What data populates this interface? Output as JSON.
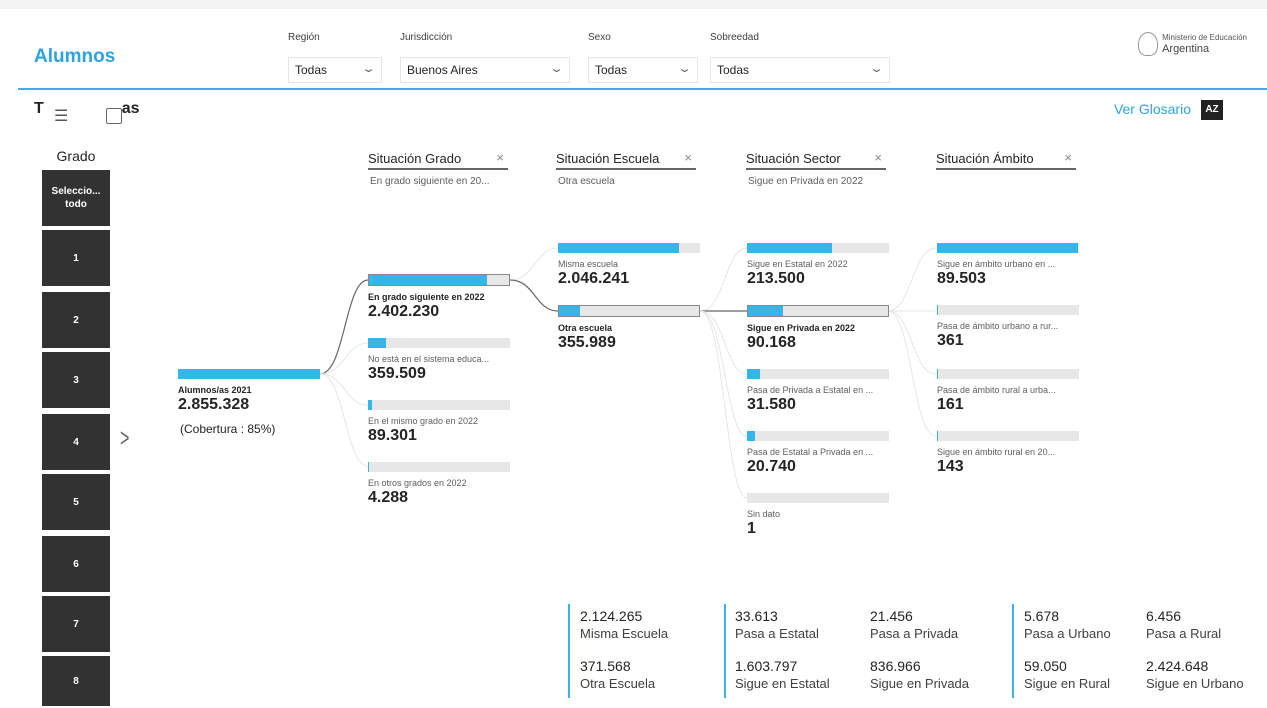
{
  "header": {
    "title": "Alumnos",
    "slicers": [
      {
        "label": "Región",
        "value": "Todas"
      },
      {
        "label": "Jurisdicción",
        "value": "Buenos Aires"
      },
      {
        "label": "Sexo",
        "value": "Todas"
      },
      {
        "label": "Sobreedad",
        "value": "Todas"
      }
    ],
    "logo_line1": "Ministerio de Educación",
    "logo_line2": "Argentina"
  },
  "visual": {
    "title_partial": "T",
    "title_end": "as",
    "glossary_link": "Ver Glosario",
    "sort_icon_text": "AZ"
  },
  "grado": {
    "label": "Grado",
    "items": [
      "Seleccio... todo",
      "1",
      "2",
      "3",
      "4",
      "5",
      "6",
      "7",
      "8"
    ]
  },
  "tree": {
    "columns": [
      {
        "title": "Situación Grado",
        "subtitle": "En grado siguiente en 20..."
      },
      {
        "title": "Situación Escuela",
        "subtitle": "Otra escuela"
      },
      {
        "title": "Situación Sector",
        "subtitle": "Sigue en Privada en 2022"
      },
      {
        "title": "Situación Ámbito",
        "subtitle": ""
      }
    ],
    "root": {
      "label": "Alumnos/as 2021",
      "value": "2.855.328",
      "fill": 1.0,
      "note": "(Cobertura : 85%)"
    },
    "grado_nodes": [
      {
        "label": "En grado siguiente en 2022",
        "value": "2.402.230",
        "fill": 0.84,
        "selected": true
      },
      {
        "label": "No está en el sistema educa...",
        "value": "359.509",
        "fill": 0.126
      },
      {
        "label": "En el mismo grado en 2022",
        "value": "89.301",
        "fill": 0.031
      },
      {
        "label": "En otros grados en 2022",
        "value": "4.288",
        "fill": 0.0015
      }
    ],
    "escuela_nodes": [
      {
        "label": "Misma escuela",
        "value": "2.046.241",
        "fill": 0.85
      },
      {
        "label": "Otra escuela",
        "value": "355.989",
        "fill": 0.148,
        "selected": true
      }
    ],
    "sector_nodes": [
      {
        "label": "Sigue en Estatal en 2022",
        "value": "213.500",
        "fill": 0.6
      },
      {
        "label": "Sigue en Privada en 2022",
        "value": "90.168",
        "fill": 0.253,
        "selected": true
      },
      {
        "label": "Pasa de Privada a Estatal en ...",
        "value": "31.580",
        "fill": 0.089
      },
      {
        "label": "Pasa de Estatal a Privada en ...",
        "value": "20.740",
        "fill": 0.058
      },
      {
        "label": "Sin dato",
        "value": "1",
        "fill": 0.0
      }
    ],
    "ambito_nodes": [
      {
        "label": "Sigue en ámbito urbano en ...",
        "value": "89.503",
        "fill": 0.993
      },
      {
        "label": "Pasa de ámbito urbano a rur...",
        "value": "361",
        "fill": 0.004
      },
      {
        "label": "Pasa de ámbito rural a urba...",
        "value": "161",
        "fill": 0.002
      },
      {
        "label": "Sigue en ámbito rural en 20...",
        "value": "143",
        "fill": 0.0016
      }
    ]
  },
  "kpis": [
    {
      "value": "2.124.265",
      "label": "Misma Escuela"
    },
    {
      "value": "371.568",
      "label": "Otra Escuela"
    },
    {
      "value": "33.613",
      "label": "Pasa a Estatal"
    },
    {
      "value": "1.603.797",
      "label": "Sigue en Estatal"
    },
    {
      "value": "21.456",
      "label": "Pasa a Privada"
    },
    {
      "value": "836.966",
      "label": "Sigue en Privada"
    },
    {
      "value": "5.678",
      "label": "Pasa a Urbano"
    },
    {
      "value": "59.050",
      "label": "Sigue en Rural"
    },
    {
      "value": "6.456",
      "label": "Pasa a Rural"
    },
    {
      "value": "2.424.648",
      "label": "Sigue en Urbano"
    }
  ]
}
